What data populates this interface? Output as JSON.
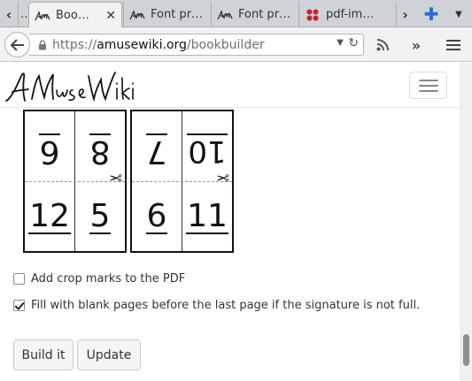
{
  "browser": {
    "tabs": [
      {
        "title": "…",
        "icon": "amusewiki-icon",
        "active": false
      },
      {
        "title": "Boo…",
        "icon": "amusewiki-icon",
        "active": true
      },
      {
        "title": "Font pr…",
        "icon": "amusewiki-icon",
        "active": false
      },
      {
        "title": "Font pr…",
        "icon": "amusewiki-icon",
        "active": false
      },
      {
        "title": "pdf-im…",
        "icon": "red-dots-icon",
        "active": false
      }
    ],
    "url": {
      "scheme": "https://",
      "host": "amusewiki.org",
      "path": "/bookbuilder"
    }
  },
  "site": {
    "logo_text": "A MuseWiki"
  },
  "imposition": {
    "sheets": [
      {
        "top": [
          "6",
          "8"
        ],
        "bottom": [
          "12",
          "5"
        ]
      },
      {
        "top": [
          "7",
          "10"
        ],
        "bottom": [
          "6",
          "11"
        ]
      }
    ],
    "scissors": "✂"
  },
  "options": {
    "crop_marks": {
      "label": "Add crop marks to the PDF",
      "checked": false
    },
    "blank_pages": {
      "label": "Fill with blank pages before the last page if the signature is not full.",
      "checked": true
    }
  },
  "buttons": {
    "build": "Build it",
    "update": "Update"
  }
}
